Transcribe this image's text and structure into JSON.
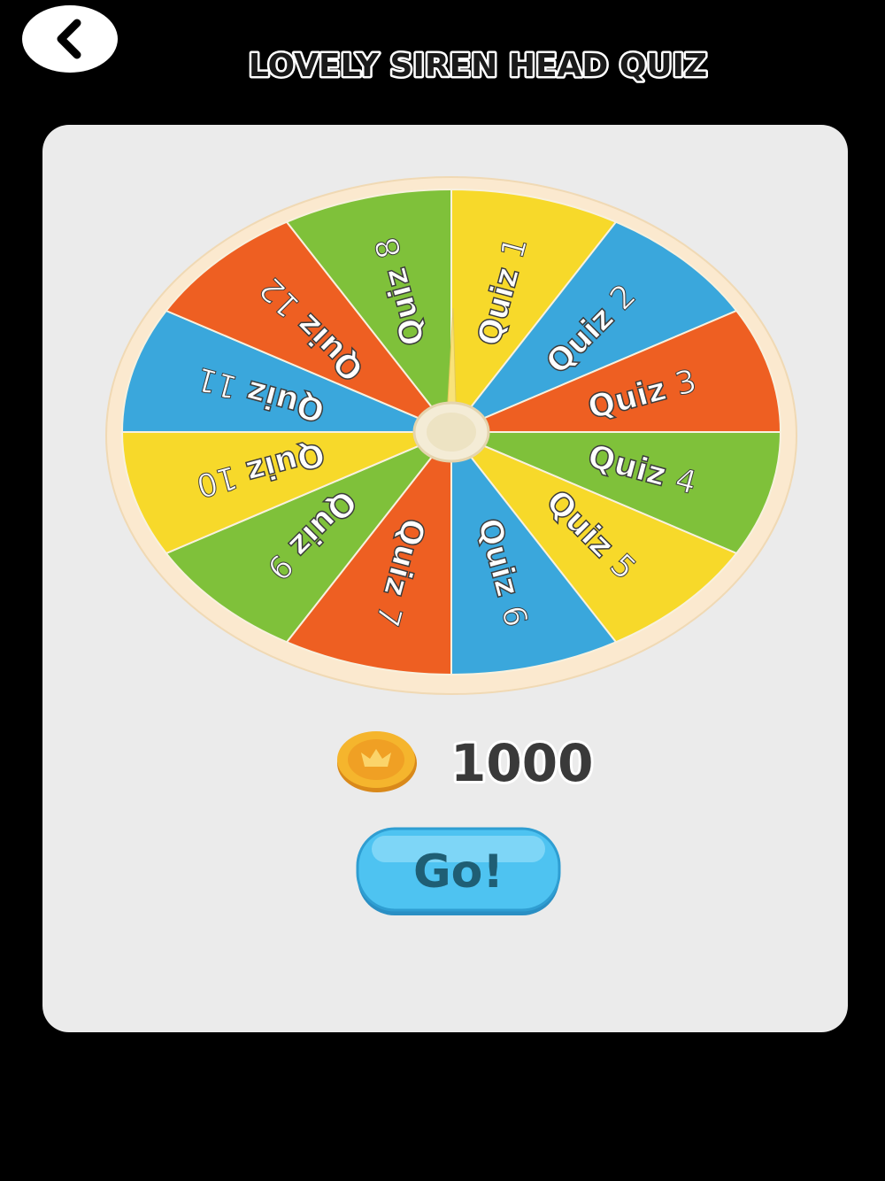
{
  "header": {
    "back_icon": "chevron-left-icon",
    "title": "LOVELY SIREN HEAD QUIZ"
  },
  "wheel": {
    "segments": [
      {
        "label": "Quiz",
        "number": "1",
        "color": "#f7d92a"
      },
      {
        "label": "Quiz",
        "number": "2",
        "color": "#3aa7dc"
      },
      {
        "label": "Quiz",
        "number": "3",
        "color": "#ee5f22"
      },
      {
        "label": "Quiz",
        "number": "4",
        "color": "#7fc13a"
      },
      {
        "label": "Quiz",
        "number": "5",
        "color": "#f7d92a"
      },
      {
        "label": "Quiz",
        "number": "6",
        "color": "#3aa7dc"
      },
      {
        "label": "Quiz",
        "number": "7",
        "color": "#ee5f22"
      },
      {
        "label": "Quiz",
        "number": "9",
        "color": "#7fc13a"
      },
      {
        "label": "Quiz",
        "number": "10",
        "color": "#f7d92a"
      },
      {
        "label": "Quiz",
        "number": "11",
        "color": "#3aa7dc"
      },
      {
        "label": "Quiz",
        "number": "12",
        "color": "#ee5f22"
      },
      {
        "label": "Quiz",
        "number": "8",
        "color": "#7fc13a"
      }
    ],
    "rim_color": "#fbe9cf",
    "pointer_color": "#f8e27a"
  },
  "coins": {
    "icon": "crown-coin-icon",
    "count": "1000"
  },
  "go_button": {
    "label": "Go!",
    "color": "#4ec3f1"
  }
}
